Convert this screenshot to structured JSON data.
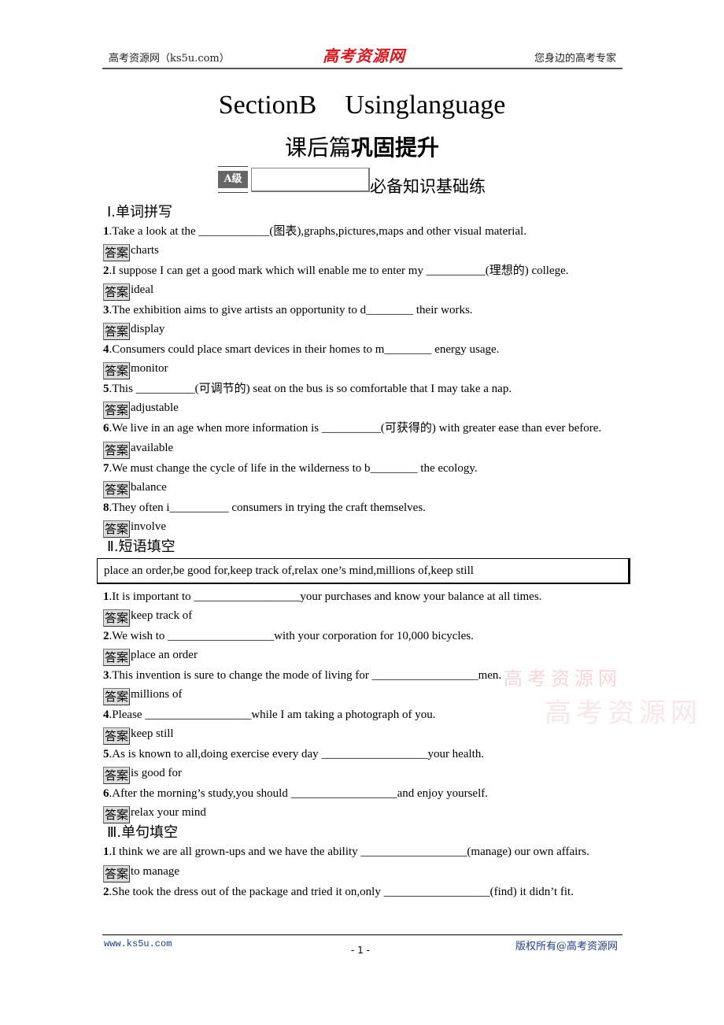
{
  "header": {
    "left": "高考资源网（ks5u.com）",
    "center_logo": "高考资源网",
    "right": "您身边的高考专家"
  },
  "title": {
    "part1": "SectionB",
    "part2": "Usinglanguage"
  },
  "subtitle": {
    "normal": "课后篇",
    "bold": "巩固提升"
  },
  "level": {
    "badge": "A级",
    "text": "必备知识基础练"
  },
  "answer_label": "答案",
  "section1": {
    "heading": "Ⅰ.单词拼写",
    "items": [
      {
        "num": "1",
        "pre": ".Take a look at the ",
        "blank": "____________",
        "post": "(图表),graphs,pictures,maps and other visual material.",
        "answer": "charts"
      },
      {
        "num": "2",
        "pre": ".I suppose I can get a good mark which will enable me to enter my ",
        "blank": "__________",
        "post": "(理想的) college.",
        "answer": "ideal"
      },
      {
        "num": "3",
        "pre": ".The exhibition aims to give artists an opportunity to ",
        "blank": "d________",
        "post": " their works.",
        "answer": "display"
      },
      {
        "num": "4",
        "pre": ".Consumers could place smart devices in their homes to ",
        "blank": "m________",
        "post": " energy usage.",
        "answer": "monitor"
      },
      {
        "num": "5",
        "pre": ".This ",
        "blank": "__________",
        "post": "(可调节的) seat on the bus is so comfortable that I may take a nap.",
        "answer": "adjustable"
      },
      {
        "num": "6",
        "pre": ".We live in an age when more information is ",
        "blank": "__________",
        "post": "(可获得的) with greater ease than ever before.",
        "answer": "available"
      },
      {
        "num": "7",
        "pre": ".We must change the cycle of life in the wilderness to ",
        "blank": "b________",
        "post": " the ecology.",
        "answer": "balance"
      },
      {
        "num": "8",
        "pre": ".They often ",
        "blank": "i__________",
        "post": " consumers in trying the craft themselves.",
        "answer": "involve"
      }
    ]
  },
  "section2": {
    "heading": "Ⅱ.短语填空",
    "phrase_bank": "place an order,be good for,keep track of,relax one’s mind,millions of,keep still",
    "items": [
      {
        "num": "1",
        "pre": ".It is important to ",
        "blank": "__________________",
        "post": "your purchases and know your balance at all times.",
        "answer": "keep track of"
      },
      {
        "num": "2",
        "pre": ".We wish to ",
        "blank": "__________________",
        "post": "with your corporation for 10,000 bicycles.",
        "answer": "place an order"
      },
      {
        "num": "3",
        "pre": ".This invention is sure to change the mode of living for ",
        "blank": "__________________",
        "post": "men.",
        "answer": "millions of"
      },
      {
        "num": "4",
        "pre": ".Please ",
        "blank": "__________________",
        "post": "while I am taking a photograph of you.",
        "answer": "keep still"
      },
      {
        "num": "5",
        "pre": ".As is known to all,doing exercise every day ",
        "blank": "__________________",
        "post": "your health.",
        "answer": "is good for"
      },
      {
        "num": "6",
        "pre": ".After the morning’s study,you should ",
        "blank": "__________________",
        "post": "and enjoy yourself.",
        "answer": "relax your mind"
      }
    ]
  },
  "section3": {
    "heading": "Ⅲ.单句填空",
    "items": [
      {
        "num": "1",
        "pre": ".I think we are all grown-ups and we have the ability ",
        "blank": "__________________",
        "post": "(manage) our own affairs.",
        "answer": "to manage"
      },
      {
        "num": "2",
        "pre": ".She took the dress out of the package and tried it on,only ",
        "blank": "__________________",
        "post": "(find) it didn’t fit.",
        "answer": null
      }
    ]
  },
  "watermark": {
    "line1": "高考资源网",
    "line2": "高考资源网"
  },
  "footer": {
    "left": "www.ks5u.com",
    "page": "- 1 -",
    "right": "版权所有@高考资源网"
  }
}
